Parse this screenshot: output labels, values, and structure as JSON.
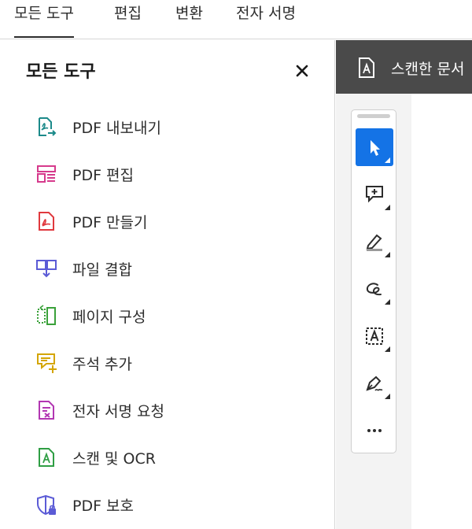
{
  "menu": {
    "tabs": [
      {
        "label": "모든 도구",
        "active": true
      },
      {
        "label": "편집"
      },
      {
        "label": "변환"
      },
      {
        "label": "전자 서명"
      }
    ]
  },
  "panel": {
    "title": "모든 도구",
    "close_icon": "close-icon",
    "tools": [
      {
        "label": "PDF 내보내기",
        "icon": "pdf-export-icon",
        "color": "#1c8a8a"
      },
      {
        "label": "PDF 편집",
        "icon": "pdf-edit-icon",
        "color": "#d63a8c"
      },
      {
        "label": "PDF 만들기",
        "icon": "pdf-create-icon",
        "color": "#e0393e"
      },
      {
        "label": "파일 결합",
        "icon": "combine-files-icon",
        "color": "#5b5bd6"
      },
      {
        "label": "페이지 구성",
        "icon": "organize-pages-icon",
        "color": "#3aa13a"
      },
      {
        "label": "주석 추가",
        "icon": "add-comment-icon",
        "color": "#d4a500"
      },
      {
        "label": "전자 서명 요청",
        "icon": "request-signature-icon",
        "color": "#b237b2"
      },
      {
        "label": "스캔 및 OCR",
        "icon": "scan-ocr-icon",
        "color": "#2f9e44"
      },
      {
        "label": "PDF 보호",
        "icon": "protect-pdf-icon",
        "color": "#5b5bd6"
      }
    ]
  },
  "document": {
    "header_title": "스캔한 문서",
    "header_icon": "scanned-document-icon"
  },
  "toolbar": {
    "tools": [
      {
        "icon": "select-arrow-icon",
        "active": true
      },
      {
        "icon": "add-comment-icon"
      },
      {
        "icon": "highlight-pen-icon"
      },
      {
        "icon": "freehand-draw-icon"
      },
      {
        "icon": "text-recognition-icon"
      },
      {
        "icon": "sign-pen-icon"
      },
      {
        "icon": "more-options-icon"
      }
    ]
  },
  "colors": {
    "accent": "#1473e6",
    "header_bg": "#4a4a4a"
  }
}
